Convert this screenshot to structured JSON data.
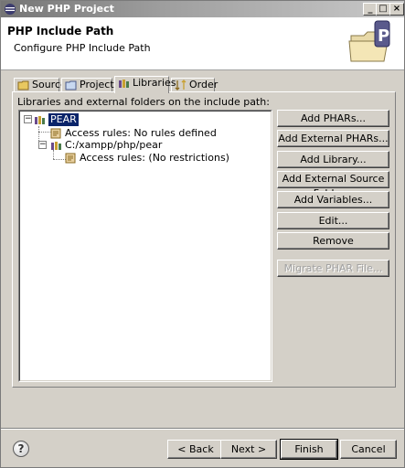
{
  "window": {
    "title": "New PHP Project",
    "controls": [
      "_",
      "□",
      "×"
    ]
  },
  "header": {
    "title": "PHP Include Path",
    "description": "Configure PHP Include Path",
    "banner_icon": "php-folder-icon"
  },
  "tabs": [
    {
      "label": "Source",
      "icon": "source-folder-icon",
      "active": false
    },
    {
      "label": "Projects",
      "icon": "projects-icon",
      "active": false
    },
    {
      "label": "Libraries",
      "icon": "libraries-icon",
      "active": true
    },
    {
      "label": "Order",
      "icon": "order-icon",
      "active": false
    }
  ],
  "libraries_panel": {
    "label": "Libraries and external folders on the include path:",
    "tree": [
      {
        "label": "PEAR",
        "level": 0,
        "expanded": true,
        "selected": true,
        "icon": "library-icon"
      },
      {
        "label": "Access rules: No rules defined",
        "level": 1,
        "icon": "access-rules-icon"
      },
      {
        "label": "C:/xampp/php/pear",
        "level": 1,
        "expanded": true,
        "icon": "library-folder-icon"
      },
      {
        "label": "Access rules: (No restrictions)",
        "level": 2,
        "icon": "access-rules-icon"
      }
    ],
    "buttons": [
      {
        "label": "Add PHARs...",
        "enabled": true
      },
      {
        "label": "Add External PHARs...",
        "enabled": true
      },
      {
        "label": "Add Library...",
        "enabled": true
      },
      {
        "label": "Add External Source Folder...",
        "enabled": true
      },
      {
        "label": "Add Variables...",
        "enabled": true
      },
      {
        "label": "Edit...",
        "enabled": true
      },
      {
        "label": "Remove",
        "enabled": true
      },
      {
        "label": "Migrate PHAR File...",
        "enabled": false
      }
    ]
  },
  "footer": {
    "help_symbol": "?",
    "back_label": "< Back",
    "next_label": "Next >",
    "finish_label": "Finish",
    "cancel_label": "Cancel"
  },
  "colors": {
    "selection": "#0a246a",
    "dialog_bg": "#d4d0c8"
  }
}
